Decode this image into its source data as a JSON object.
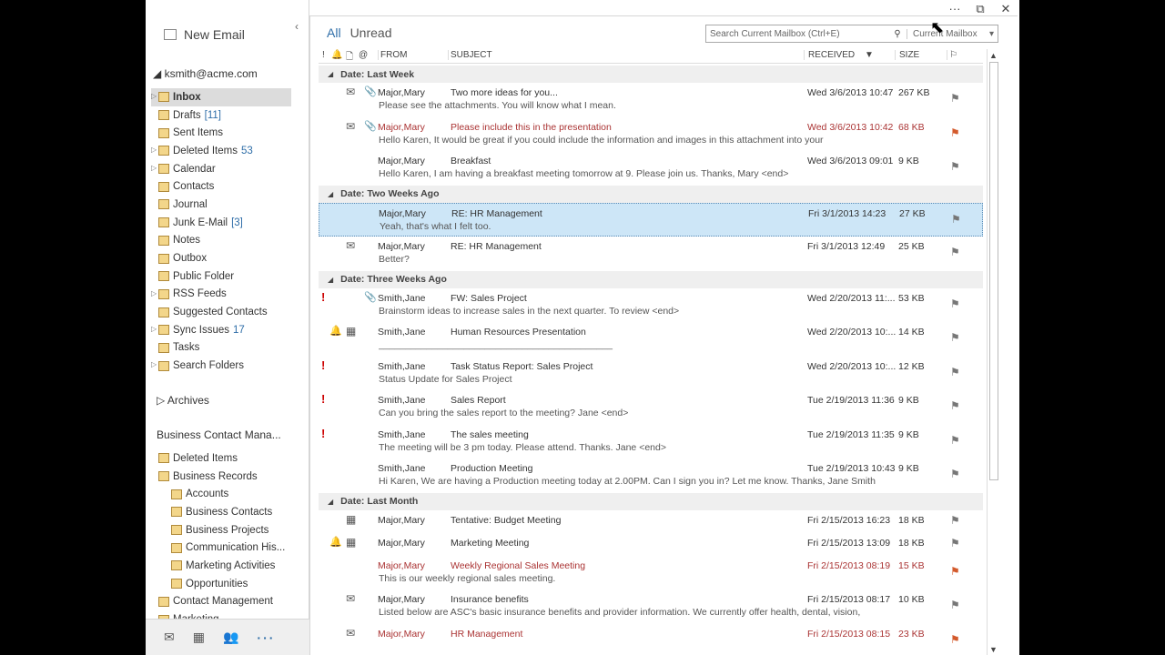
{
  "window": {
    "more": "···",
    "restore": "⧉",
    "close": "✕"
  },
  "nav": {
    "new_email": "New Email",
    "collapse": "‹",
    "account": "ksmith@acme.com",
    "folders": [
      {
        "label": "Inbox",
        "count": "",
        "selected": true,
        "expandable": true
      },
      {
        "label": "Drafts",
        "count": "[11]",
        "expandable": false
      },
      {
        "label": "Sent Items",
        "count": "",
        "expandable": false
      },
      {
        "label": "Deleted Items",
        "count": "53",
        "expandable": true
      },
      {
        "label": "Calendar",
        "count": "",
        "expandable": true
      },
      {
        "label": "Contacts",
        "count": "",
        "expandable": false
      },
      {
        "label": "Journal",
        "count": "",
        "expandable": false
      },
      {
        "label": "Junk E-Mail",
        "count": "[3]",
        "expandable": false
      },
      {
        "label": "Notes",
        "count": "",
        "expandable": false
      },
      {
        "label": "Outbox",
        "count": "",
        "expandable": false
      },
      {
        "label": "Public Folder",
        "count": "",
        "expandable": false
      },
      {
        "label": "RSS Feeds",
        "count": "",
        "expandable": true
      },
      {
        "label": "Suggested Contacts",
        "count": "",
        "expandable": false
      },
      {
        "label": "Sync Issues",
        "count": "17",
        "expandable": true
      },
      {
        "label": "Tasks",
        "count": "",
        "expandable": false
      },
      {
        "label": "Search Folders",
        "count": "",
        "expandable": true
      }
    ],
    "archives": "Archives",
    "bcm_title": "Business Contact Mana...",
    "bcm_items": [
      {
        "label": "Deleted Items",
        "sub": false
      },
      {
        "label": "Business Records",
        "sub": false
      },
      {
        "label": "Accounts",
        "sub": true
      },
      {
        "label": "Business Contacts",
        "sub": true
      },
      {
        "label": "Business Projects",
        "sub": true
      },
      {
        "label": "Communication His...",
        "sub": true
      },
      {
        "label": "Marketing Activities",
        "sub": true
      },
      {
        "label": "Opportunities",
        "sub": true
      },
      {
        "label": "Contact Management",
        "sub": false
      },
      {
        "label": "Marketing",
        "sub": false
      }
    ],
    "bottom": {
      "mail": "✉",
      "calendar": "▦",
      "people": "👥",
      "more": "···"
    }
  },
  "main": {
    "filter_all": "All",
    "filter_unread": "Unread",
    "search_placeholder": "Search Current Mailbox (Ctrl+E)",
    "search_scope": "Current Mailbox",
    "columns": {
      "importance": "!",
      "reminder": "🔔",
      "icon": "🗋",
      "attach": "@",
      "from": "FROM",
      "subject": "SUBJECT",
      "received": "RECEIVED",
      "size": "SIZE",
      "flag": "⚐"
    },
    "groups": [
      {
        "title": "Date: Last Week",
        "messages": [
          {
            "from": "Major,Mary",
            "subject": "Two more ideas for you...",
            "received": "Wed 3/6/2013 10:47",
            "size": "267 KB",
            "preview": "Please see the attachments.  You will know what I mean.",
            "icon": "✉",
            "clip": true,
            "red": false
          },
          {
            "from": "Major,Mary",
            "subject": "Please include this in the presentation",
            "received": "Wed 3/6/2013 10:42",
            "size": "68 KB",
            "preview": "Hello Karen,  It would be great if you could include the information and images in this attachment into your",
            "icon": "✉",
            "clip": true,
            "red": true,
            "flag_red": true
          },
          {
            "from": "Major,Mary",
            "subject": "Breakfast",
            "received": "Wed 3/6/2013 09:01",
            "size": "9 KB",
            "preview": "Hello Karen,  I am having a breakfast meeting tomorrow at 9. Please join us.  Thanks,  Mary <end>"
          }
        ]
      },
      {
        "title": "Date: Two Weeks Ago",
        "messages": [
          {
            "from": "Major,Mary",
            "subject": "RE: HR Management",
            "received": "Fri 3/1/2013 14:23",
            "size": "27 KB",
            "preview": "Yeah, that's what I felt too.",
            "selected": true
          },
          {
            "from": "Major,Mary",
            "subject": "RE: HR Management",
            "received": "Fri 3/1/2013 12:49",
            "size": "25 KB",
            "preview": "Better?",
            "icon": "✉"
          }
        ]
      },
      {
        "title": "Date: Three Weeks Ago",
        "messages": [
          {
            "from": "Smith,Jane",
            "subject": "FW: Sales Project",
            "received": "Wed 2/20/2013 11:...",
            "size": "53 KB",
            "preview": "Brainstorm ideas to increase sales in the next quarter.  To review <end>",
            "imp": true,
            "clip": true
          },
          {
            "from": "Smith,Jane",
            "subject": "Human Resources Presentation",
            "received": "Wed 2/20/2013 10:...",
            "size": "14 KB",
            "preview": "____________________________________________",
            "bell": true,
            "icon": "▦"
          },
          {
            "from": "Smith,Jane",
            "subject": "Task Status Report: Sales Project",
            "received": "Wed 2/20/2013 10:...",
            "size": "12 KB",
            "preview": "Status Update for Sales Project",
            "imp": true
          },
          {
            "from": "Smith,Jane",
            "subject": "Sales Report",
            "received": "Tue 2/19/2013 11:36",
            "size": "9 KB",
            "preview": "Can you bring the sales report to the meeting?  Jane <end>",
            "imp": true
          },
          {
            "from": "Smith,Jane",
            "subject": "The sales meeting",
            "received": "Tue 2/19/2013 11:35",
            "size": "9 KB",
            "preview": "The meeting will be 3 pm today. Please attend.  Thanks.  Jane <end>",
            "imp": true
          },
          {
            "from": "Smith,Jane",
            "subject": "Production Meeting",
            "received": "Tue 2/19/2013 10:43",
            "size": "9 KB",
            "preview": "Hi Karen,  We are having a Production meeting today at 2.00PM.    Can I sign you in? Let me know.  Thanks,  Jane Smith"
          }
        ]
      },
      {
        "title": "Date: Last Month",
        "messages": [
          {
            "from": "Major,Mary",
            "subject": "Tentative: Budget Meeting",
            "received": "Fri 2/15/2013 16:23",
            "size": "18 KB",
            "preview": "",
            "icon": "▦",
            "single": true
          },
          {
            "from": "Major,Mary",
            "subject": "Marketing Meeting",
            "received": "Fri 2/15/2013 13:09",
            "size": "18 KB",
            "preview": "",
            "icon": "▦",
            "bell": true,
            "single": true
          },
          {
            "from": "Major,Mary",
            "subject": "Weekly Regional Sales Meeting",
            "received": "Fri 2/15/2013 08:19",
            "size": "15 KB",
            "preview": "This is our weekly regional sales meeting.",
            "red": true,
            "flag_red": true
          },
          {
            "from": "Major,Mary",
            "subject": "Insurance benefits",
            "received": "Fri 2/15/2013 08:17",
            "size": "10 KB",
            "preview": "Listed below are ASC's basic insurance benefits and provider information. We currently offer health, dental, vision,",
            "icon": "✉"
          },
          {
            "from": "Major,Mary",
            "subject": "HR Management",
            "received": "Fri 2/15/2013 08:15",
            "size": "23 KB",
            "preview": "",
            "icon": "✉",
            "red": true,
            "flag_red": true
          }
        ]
      }
    ]
  }
}
